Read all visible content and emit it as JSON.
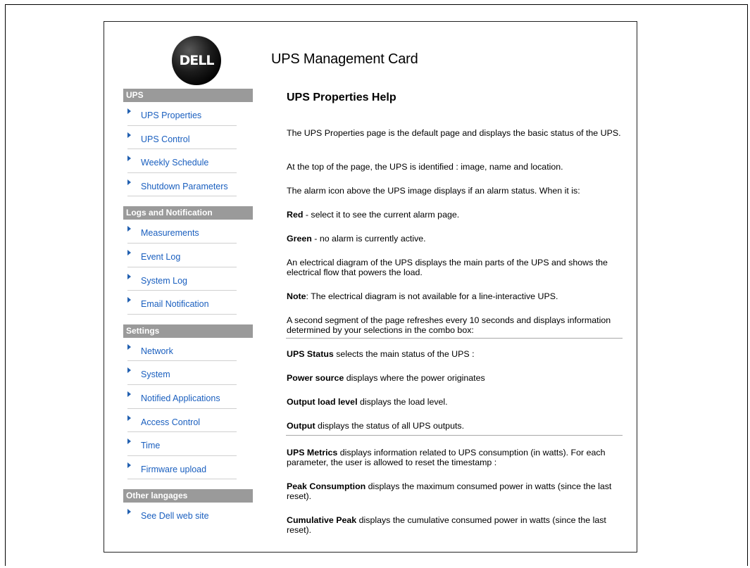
{
  "logo": {
    "text": "DELL"
  },
  "app_title": "UPS Management Card",
  "sidebar": {
    "sections": [
      {
        "header": "UPS",
        "items": [
          {
            "label": "UPS Properties"
          },
          {
            "label": "UPS Control"
          },
          {
            "label": "Weekly Schedule"
          },
          {
            "label": "Shutdown Parameters"
          }
        ]
      },
      {
        "header": "Logs and Notification",
        "items": [
          {
            "label": "Measurements"
          },
          {
            "label": "Event Log"
          },
          {
            "label": "System Log"
          },
          {
            "label": "Email Notification"
          }
        ]
      },
      {
        "header": "Settings",
        "items": [
          {
            "label": "Network"
          },
          {
            "label": "System"
          },
          {
            "label": "Notified Applications"
          },
          {
            "label": "Access Control"
          },
          {
            "label": "Time"
          },
          {
            "label": "Firmware upload"
          }
        ]
      },
      {
        "header": "Other langages",
        "items": [
          {
            "label": "See Dell web site"
          }
        ]
      }
    ]
  },
  "content": {
    "title": "UPS Properties Help",
    "paragraphs": [
      {
        "bold": "",
        "text": "The UPS Properties page is the default page and displays the basic status of the UPS."
      },
      {
        "bold": "",
        "text": "At the top of the page, the UPS is identified : image, name and location."
      },
      {
        "bold": "",
        "text": "The alarm icon above the UPS image displays if an alarm status. When it is:"
      },
      {
        "bold": "Red",
        "text": " - select it to see the current alarm page."
      },
      {
        "bold": "Green",
        "text": " - no alarm is currently active."
      },
      {
        "bold": "",
        "text": "An electrical diagram of the UPS displays the main parts of the UPS and shows the electrical flow that powers the load."
      },
      {
        "bold": "Note",
        "text": ": The electrical diagram is not available for a line-interactive UPS."
      },
      {
        "bold": "",
        "text": "A second segment of the page refreshes every 10 seconds and displays information determined by your selections in the combo box:"
      },
      {
        "bold": "UPS Status",
        "text": " selects the main status of the UPS :"
      },
      {
        "bold": "Power source",
        "text": " displays where the power originates"
      },
      {
        "bold": "Output load level",
        "text": " displays the load level."
      },
      {
        "bold": "Output",
        "text": " displays the status of all UPS outputs."
      },
      {
        "bold": "UPS Metrics",
        "text": " displays information related to UPS consumption (in watts). For each parameter, the user is allowed to reset the timestamp :"
      },
      {
        "bold": "Peak Consumption",
        "text": " displays the maximum consumed power in watts (since the last reset)."
      },
      {
        "bold": "Cumulative Peak",
        "text": " displays the cumulative consumed power in watts (since the last reset)."
      }
    ]
  },
  "colors": {
    "section_header_bg": "#9a9a9a",
    "link": "#1a5fbf",
    "arrow": "#2260b0"
  }
}
